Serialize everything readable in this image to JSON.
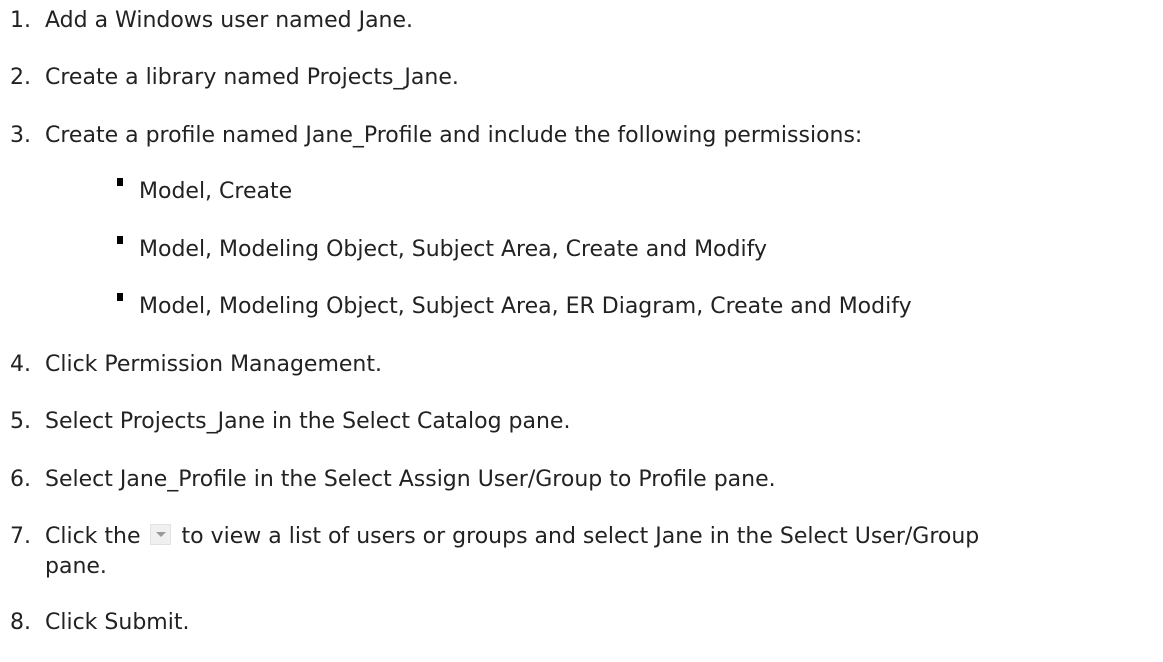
{
  "steps": [
    {
      "num": "1.",
      "text": "Add a Windows user named Jane."
    },
    {
      "num": "2.",
      "text": "Create a library named Projects_Jane."
    },
    {
      "num": "3.",
      "text": "Create a profile named Jane_Profile and include the following permissions:"
    },
    {
      "num": "4.",
      "text": "Click Permission Management."
    },
    {
      "num": "5.",
      "text": "Select Projects_Jane in the Select Catalog pane."
    },
    {
      "num": "6.",
      "text": "Select Jane_Profile in the Select Assign User/Group to Profile pane."
    },
    {
      "num": "7.",
      "text_before": "Click the",
      "text_after": "to view a list of users or groups and select Jane in the Select User/Group",
      "text_line2": "pane."
    },
    {
      "num": "8.",
      "text": "Click Submit."
    }
  ],
  "permissions": [
    "Model, Create",
    "Model, Modeling Object, Subject Area, Create and Modify",
    "Model, Modeling Object, Subject Area, ER Diagram, Create and Modify"
  ],
  "icons": {
    "dropdown": "dropdown-arrow-icon"
  }
}
